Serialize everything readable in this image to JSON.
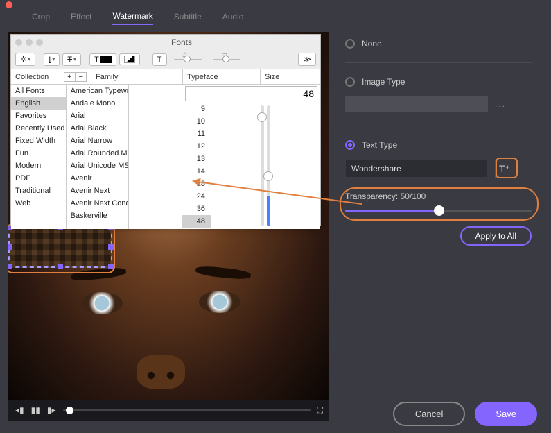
{
  "tabs": [
    "Crop",
    "Effect",
    "Watermark",
    "Subtitle",
    "Audio"
  ],
  "activeTab": "Watermark",
  "fonts": {
    "title": "Fonts",
    "columns": {
      "collection": "Collection",
      "family": "Family",
      "typeface": "Typeface",
      "size": "Size"
    },
    "collections": [
      "All Fonts",
      "English",
      "Favorites",
      "Recently Used",
      "Fixed Width",
      "Fun",
      "Modern",
      "PDF",
      "Traditional",
      "Web"
    ],
    "collections_selected": "English",
    "families": [
      "American Typewrite",
      "Andale Mono",
      "Arial",
      "Arial Black",
      "Arial Narrow",
      "Arial Rounded MT B",
      "Arial Unicode MS",
      "Avenir",
      "Avenir Next",
      "Avenir Next Conder",
      "Baskerville"
    ],
    "sizes": [
      "9",
      "10",
      "11",
      "12",
      "13",
      "14",
      "18",
      "24",
      "36",
      "48"
    ],
    "size_selected": "48",
    "size_value": "48"
  },
  "side": {
    "none": "None",
    "imageType": "Image Type",
    "dots": "...",
    "textType": "Text Type",
    "textValue": "Wondershare",
    "ttGlyph": "T⁺",
    "transparency": "Transparency: 50/100",
    "applyAll": "Apply to All"
  },
  "player": {
    "prev": "◂▮",
    "pause": "▮▮",
    "next": "▮▸",
    "fs": "⛶"
  },
  "footer": {
    "cancel": "Cancel",
    "save": "Save"
  }
}
